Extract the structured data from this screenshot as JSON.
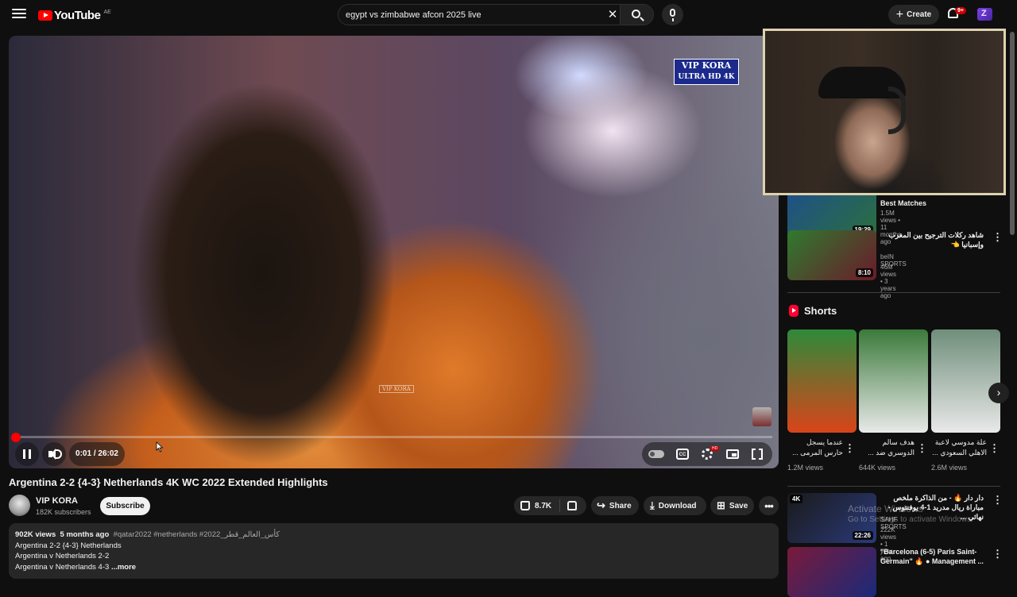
{
  "header": {
    "logo_text": "YouTube",
    "country_code": "AE",
    "search_value": "egypt vs zimbabwe afcon 2025 live",
    "search_placeholder": "Search",
    "create_label": "Create",
    "notifications_badge": "9+"
  },
  "player": {
    "watermark_line1": "VIP KORA",
    "watermark_line2": "ULTRA HD 4K",
    "watermark_small": "VIP KORA",
    "time_current": "0:01",
    "time_total": "26:02",
    "time_display": "0:01 / 26:02",
    "progress_fraction": 0.0006,
    "cc_label": "CC",
    "settings_badge": "HD"
  },
  "video": {
    "title": "Argentina 2-2 {4-3} Netherlands 4K WC 2022 Extended Highlights",
    "channel_name": "VIP KORA",
    "subscribers": "182K subscribers",
    "subscribe_label": "Subscribe",
    "likes": "8.7K",
    "share_label": "Share",
    "download_label": "Download",
    "save_label": "Save"
  },
  "description": {
    "views": "902K views",
    "age": "5 months ago",
    "tags": "#qatar2022 #netherlands #كأس_العالم_قطر_2022",
    "line1": "Argentina 2-2 {4-3} Netherlands",
    "line2": "Argentina v Netherlands 2-2",
    "line3": "Argentina v Netherlands 4-3",
    "more_label": "...more"
  },
  "sidebar": {
    "recs_top": [
      {
        "title": "Best Matches",
        "channel": "",
        "meta": "1.5M views • 11 months ago",
        "duration": "19:29",
        "thumb_colors": [
          "#1e4f8a",
          "#2b6f3e"
        ]
      },
      {
        "title": "شاهد ركلات الترجيح بين المغرب وإسبانيا 👈",
        "channel": "beIN SPORTS",
        "meta": "46M views • 3 years ago",
        "duration": "8:10",
        "thumb_colors": [
          "#2f7a2f",
          "#6b1a2a"
        ]
      }
    ],
    "shorts_heading": "Shorts",
    "shorts": [
      {
        "title": "عندما يسجل حارس المرمى ...",
        "views": "1.2M views",
        "colors": [
          "#2e8a3a",
          "#d9441a"
        ]
      },
      {
        "title": "هدف سالم الدوسري ضد ...",
        "views": "644K views",
        "colors": [
          "#3b7a3b",
          "#e9e9e9"
        ]
      },
      {
        "title": "علة مدوسي لاعبة الاهلي السعودي ...",
        "views": "2.6M views",
        "colors": [
          "#6f8e7a",
          "#e9e9e9"
        ]
      }
    ],
    "recs_bottom": [
      {
        "title": "دار دار 🔥 - من الذاكرة ملخص مباراة ريال مدريد 1-4 يوفنتوس - نهائي ...",
        "channel": "SAHF SPORTS",
        "meta": "222K views • 1 year ago",
        "duration": "22:26",
        "badge": "4K",
        "thumb_colors": [
          "#1a1a1a",
          "#2a3a7a"
        ]
      },
      {
        "title": "\"Barcelona (6-5) Paris Saint-Germain\" 🔥 ● Management ...",
        "channel": "",
        "meta": "",
        "duration": "",
        "thumb_colors": [
          "#7a1a3a",
          "#1a2a7a"
        ]
      }
    ],
    "activate_line1": "Activate Windows",
    "activate_line2": "Go to Settings to activate Windows."
  },
  "colors": {
    "accent": "#ff0000",
    "background": "#0f0f0f",
    "pill": "#272727"
  }
}
